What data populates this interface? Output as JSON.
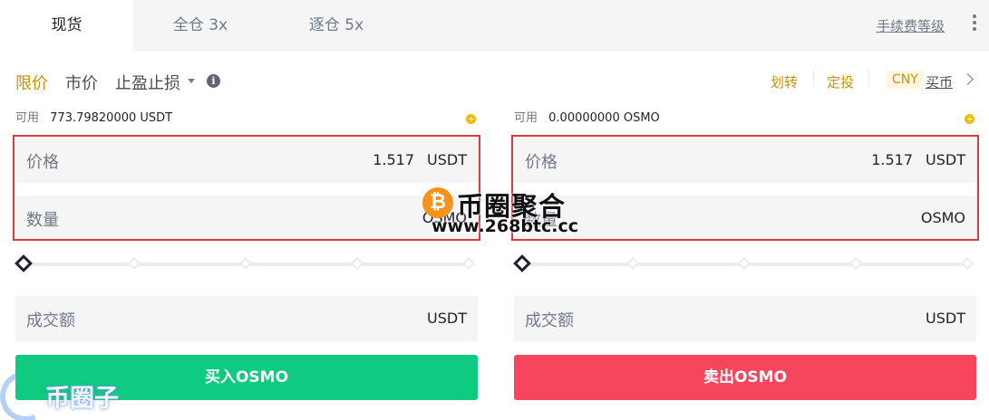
{
  "tabs": [
    {
      "label": "现货",
      "active": true
    },
    {
      "label": "全仓 3x",
      "active": false
    },
    {
      "label": "逐仓 5x",
      "active": false
    }
  ],
  "fee_link": "手续费等级",
  "order_types": {
    "limit": "限价",
    "market": "市价",
    "stop": "止盈止损"
  },
  "info_icon_glyph": "i",
  "links": {
    "transfer": "划转",
    "dca": "定投",
    "currency": "CNY",
    "buy_coin": "买币"
  },
  "buy_panel": {
    "avail_label": "可用",
    "avail_value": "773.79820000 USDT",
    "price_label": "价格",
    "price_value": "1.517",
    "price_unit": "USDT",
    "qty_label": "数量",
    "qty_unit": "OSMO",
    "total_label": "成交额",
    "total_unit": "USDT",
    "slider_percent": 0,
    "button_label": "买入OSMO"
  },
  "sell_panel": {
    "avail_label": "可用",
    "avail_value": "0.00000000 OSMO",
    "price_label": "价格",
    "price_value": "1.517",
    "price_unit": "USDT",
    "qty_label": "数量",
    "qty_unit": "OSMO",
    "total_label": "成交额",
    "total_unit": "USDT",
    "slider_percent": 0,
    "button_label": "卖出OSMO"
  },
  "watermark": {
    "coin_glyph": "₿",
    "title": "币圈聚合",
    "url": "www.268btc.cc",
    "corner": "币圈子"
  },
  "colors": {
    "accent": "#c99400",
    "buy": "#0ecb81",
    "sell": "#f6465d",
    "highlight_border": "#d93a3a"
  }
}
